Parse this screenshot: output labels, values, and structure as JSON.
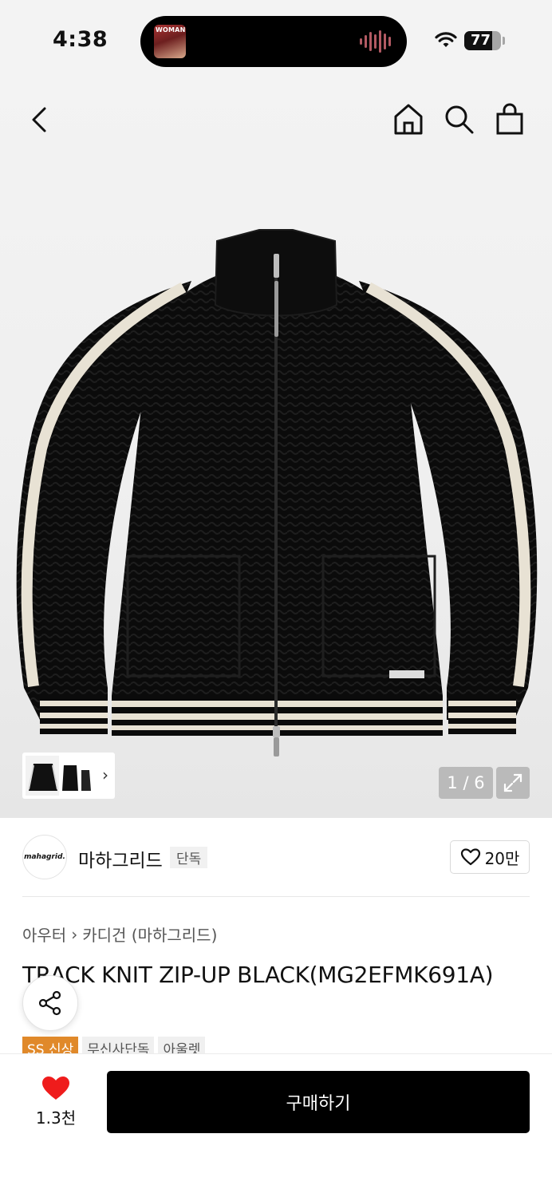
{
  "status_bar": {
    "time": "4:38",
    "now_playing_art_text": "WOMAN",
    "battery_level": 77,
    "battery_text": "77"
  },
  "nav": {
    "icons": [
      "back-icon",
      "home-icon",
      "search-icon",
      "bag-icon"
    ]
  },
  "gallery": {
    "counter": "1 / 6",
    "current_index": 1,
    "total": 6,
    "thumb_chevron": "›"
  },
  "brand": {
    "logo_text": "mahagrid.",
    "name": "마하그리드",
    "badge": "단독",
    "likes": "20만"
  },
  "breadcrumb": {
    "items": [
      "아우터",
      "카디건 (마하그리드)"
    ],
    "separator": "›"
  },
  "product": {
    "title": "TRACK KNIT ZIP-UP BLACK(MG2EFMK691A)",
    "tags": [
      "SS 신상",
      "무신사단독",
      "아울렛"
    ],
    "accent_color": "#e0892a"
  },
  "bottom_bar": {
    "like_count": "1.3천",
    "heart_color": "#ef1c1c",
    "buy_label": "구매하기"
  }
}
